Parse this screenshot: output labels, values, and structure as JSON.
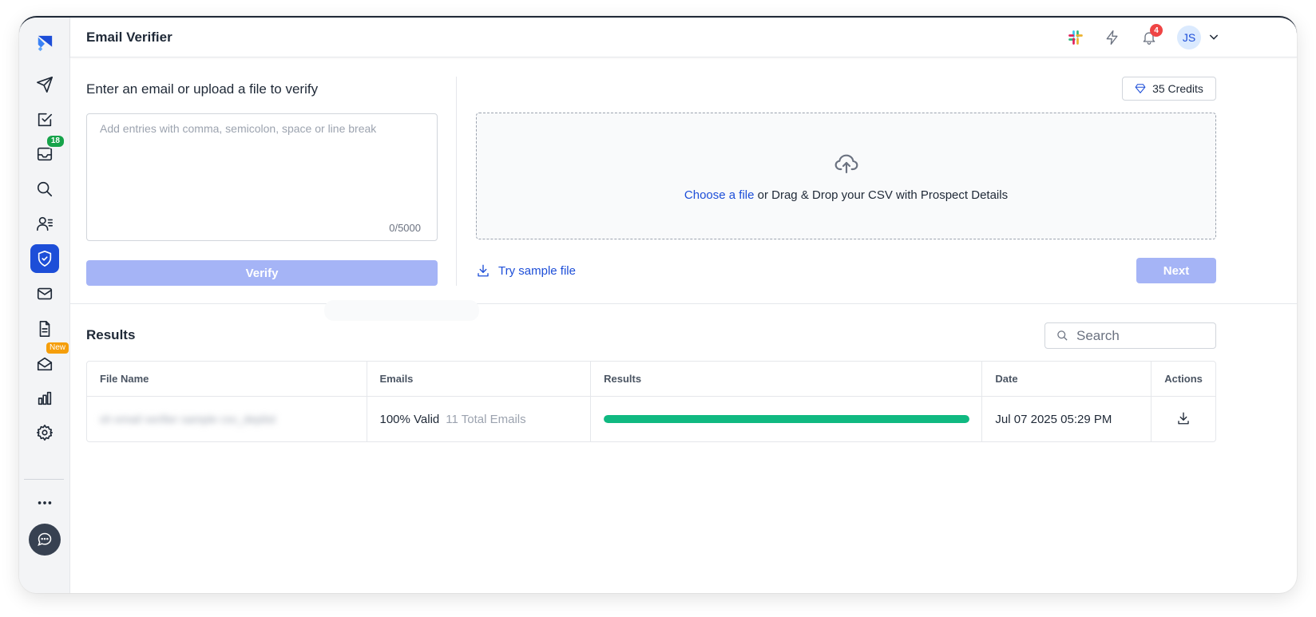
{
  "header": {
    "title": "Email Verifier",
    "notification_count": "4",
    "avatar_initials": "JS"
  },
  "sidebar": {
    "items": [
      {
        "icon": "logo-icon"
      },
      {
        "icon": "send-icon"
      },
      {
        "icon": "task-check-icon"
      },
      {
        "icon": "inbox-icon",
        "badge": "18"
      },
      {
        "icon": "search-icon"
      },
      {
        "icon": "prospects-icon"
      },
      {
        "icon": "shield-check-icon",
        "active": true
      },
      {
        "icon": "mail-icon"
      },
      {
        "icon": "document-icon"
      },
      {
        "icon": "mail-open-icon",
        "badge": "New"
      },
      {
        "icon": "bar-chart-icon"
      },
      {
        "icon": "gear-icon"
      },
      {
        "icon": "more-icon"
      },
      {
        "icon": "chat-icon"
      }
    ]
  },
  "verify": {
    "heading": "Enter an email or upload a file to verify",
    "placeholder": "Add entries with comma, semicolon, space or line break",
    "char_count": "0/5000",
    "verify_label": "Verify"
  },
  "upload": {
    "credits_label": "35 Credits",
    "choose_file_label": "Choose a file",
    "drop_text": " or Drag & Drop your CSV with Prospect Details",
    "sample_label": "Try sample file",
    "next_label": "Next"
  },
  "results": {
    "title": "Results",
    "search_placeholder": "Search",
    "columns": [
      "File Name",
      "Emails",
      "Results",
      "Date",
      "Actions"
    ],
    "rows": [
      {
        "file_name": "sh email verifier sample csv_deplist",
        "valid": "100% Valid",
        "total": "11 Total Emails",
        "valid_fraction": 1.0,
        "date": "Jul 07 2025 05:29 PM"
      }
    ]
  },
  "colors": {
    "accent": "#1d4ed8",
    "disabled_button": "#a5b4f6",
    "success": "#10b981",
    "badge_green": "#16a34a",
    "badge_new": "#f59e0b",
    "notification": "#ef4444"
  }
}
